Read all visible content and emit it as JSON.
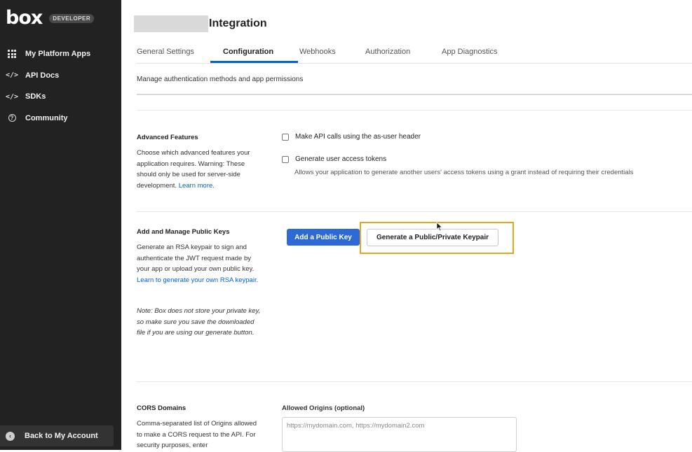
{
  "sidebar": {
    "logo": "box",
    "badge": "DEVELOPER",
    "items": [
      {
        "label": "My Platform Apps",
        "icon": "grid-icon"
      },
      {
        "label": "API Docs",
        "icon": "code-icon"
      },
      {
        "label": "SDKs",
        "icon": "code-icon"
      },
      {
        "label": "Community",
        "icon": "help-circle-icon"
      }
    ],
    "back_label": "Back to My Account"
  },
  "header": {
    "title": "Integration"
  },
  "tabs": [
    {
      "label": "General Settings",
      "active": false
    },
    {
      "label": "Configuration",
      "active": true
    },
    {
      "label": "Webhooks",
      "active": false
    },
    {
      "label": "Authorization",
      "active": false
    },
    {
      "label": "App Diagnostics",
      "active": false
    }
  ],
  "subtitle": "Manage authentication methods and app permissions",
  "advanced_features": {
    "title": "Advanced Features",
    "description": "Choose which advanced features your application requires. Warning: These should only be used for server-side development.",
    "learn_more": "Learn more.",
    "options": [
      {
        "label": "Make API calls using the as-user header",
        "checked": false
      },
      {
        "label": "Generate user access tokens",
        "checked": false,
        "help": "Allows your application to generate another users' access tokens using a grant instead of requiring their credentials"
      }
    ]
  },
  "public_keys": {
    "title": "Add and Manage Public Keys",
    "description": "Generate an RSA keypair to sign and authenticate the JWT request made by your app or upload your own public key.",
    "link": "Learn to generate your own RSA keypair.",
    "note": "Note: Box does not store your private key, so make sure you save the downloaded file if you are using our generate button.",
    "add_button": "Add a Public Key",
    "generate_button": "Generate a Public/Private Keypair"
  },
  "cors": {
    "title": "CORS Domains",
    "description": "Comma-separated list of Origins allowed to make a CORS request to the API. For security purposes, enter",
    "field_label": "Allowed Origins (optional)",
    "placeholder": "https://mydomain.com, https://mydomain2.com"
  },
  "colors": {
    "sidebar_bg": "#222222",
    "primary": "#2d6ad6",
    "link": "#0061d5",
    "highlight": "#e8a41c"
  }
}
